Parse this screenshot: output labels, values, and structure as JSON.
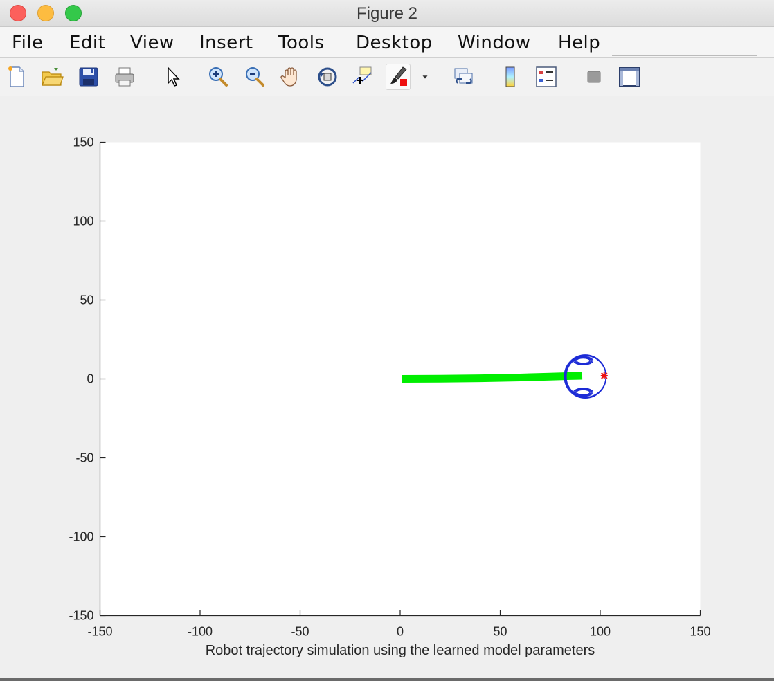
{
  "window": {
    "title": "Figure 2"
  },
  "menu": [
    "File",
    "Edit",
    "View",
    "Insert",
    "Tools",
    "Desktop",
    "Window",
    "Help"
  ],
  "toolbar": {
    "buttons": [
      "new-figure",
      "open-file",
      "save",
      "print",
      "edit-plot",
      "zoom-in",
      "zoom-out",
      "pan",
      "rotate-3d",
      "data-cursor",
      "brush",
      "link-plot",
      "insert-colorbar",
      "insert-legend",
      "hide-plot-tools",
      "show-plot-tools"
    ]
  },
  "chart_data": {
    "type": "line",
    "title": "",
    "xlabel": "Robot trajectory simulation using the learned model parameters",
    "ylabel": "",
    "xlim": [
      -150,
      150
    ],
    "ylim": [
      -150,
      150
    ],
    "xticks": [
      "-150",
      "-100",
      "-50",
      "0",
      "50",
      "100",
      "150"
    ],
    "yticks": [
      "150",
      "100",
      "50",
      "0",
      "-50",
      "-100",
      "-150"
    ],
    "grid": false,
    "series": [
      {
        "color": "#00ee00",
        "x": [
          1,
          20,
          40,
          60,
          75,
          85,
          91
        ],
        "y": [
          0,
          0.1,
          0.4,
          0.9,
          1.4,
          1.8,
          2.0
        ]
      }
    ],
    "robot": {
      "body_center": [
        92.5,
        1.5
      ],
      "body_radius": 10.5,
      "wheel_top": [
        91.5,
        11.5
      ],
      "wheel_bottom": [
        91.5,
        -8.5
      ],
      "heading_marker": [
        102,
        2
      ],
      "body_color": "#1c2bd6",
      "marker_color": "#ee1111"
    }
  }
}
